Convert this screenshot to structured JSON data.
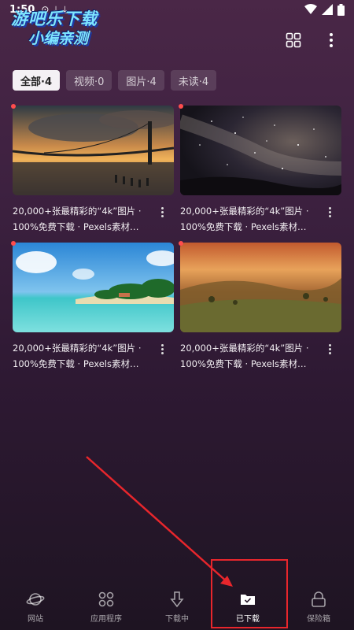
{
  "status": {
    "time": "1:50"
  },
  "watermark": {
    "line1": "游吧乐下载",
    "line2": "小编亲测"
  },
  "filters": [
    {
      "label": "全部·4",
      "active": true
    },
    {
      "label": "视频·0",
      "active": false
    },
    {
      "label": "图片·4",
      "active": false
    },
    {
      "label": "未读·4",
      "active": false
    }
  ],
  "items": [
    {
      "caption": "20,000+张最精彩的“4k”图片 · 100%免费下载 · Pexels素材…",
      "image": "bridge-sunset",
      "unread": true
    },
    {
      "caption": "20,000+张最精彩的“4k”图片 · 100%免费下载 · Pexels素材…",
      "image": "starry-sky",
      "unread": true
    },
    {
      "caption": "20,000+张最精彩的“4k”图片 · 100%免费下载 · Pexels素材…",
      "image": "tropical-beach",
      "unread": true
    },
    {
      "caption": "20,000+张最精彩的“4k”图片 · 100%免费下载 · Pexels素材…",
      "image": "autumn-hills",
      "unread": true
    }
  ],
  "nav": [
    {
      "label": "网站",
      "icon": "planet-icon",
      "active": false
    },
    {
      "label": "应用程序",
      "icon": "apps-grid-icon",
      "active": false
    },
    {
      "label": "下载中",
      "icon": "download-arrow-icon",
      "active": false
    },
    {
      "label": "已下载",
      "icon": "downloaded-folder-icon",
      "active": true
    },
    {
      "label": "保险箱",
      "icon": "lock-icon",
      "active": false
    }
  ],
  "colors": {
    "accent_annotation": "#e8262c",
    "unread_dot": "#ff4d4d"
  }
}
